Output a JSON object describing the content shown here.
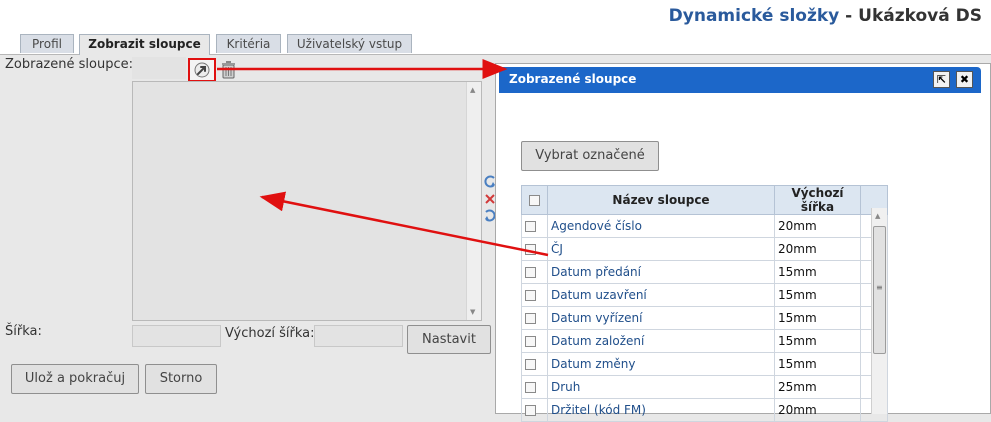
{
  "header": {
    "module": "Dynamické složky",
    "separator": " - ",
    "page": "Ukázková DS"
  },
  "tabs": [
    {
      "label": "Profil",
      "active": false
    },
    {
      "label": "Zobrazit sloupce",
      "active": true
    },
    {
      "label": "Kritéria",
      "active": false
    },
    {
      "label": "Uživatelský vstup",
      "active": false
    }
  ],
  "form": {
    "displayed_columns_label": "Zobrazené sloupce:",
    "width_label": "Šířka:",
    "default_width_label": "Výchozí šířka:",
    "set_button": "Nastavit",
    "save_continue_button": "Ulož a pokračuj",
    "cancel_button": "Storno"
  },
  "dialog": {
    "title": "Zobrazené sloupce",
    "select_marked_button": "Vybrat označené",
    "headers": {
      "name": "Název sloupce",
      "default_width": "Výchozí šířka"
    },
    "rows": [
      {
        "name": "Agendové číslo",
        "width": "20mm"
      },
      {
        "name": "ČJ",
        "width": "20mm"
      },
      {
        "name": "Datum předání",
        "width": "15mm"
      },
      {
        "name": "Datum uzavření",
        "width": "15mm"
      },
      {
        "name": "Datum vyřízení",
        "width": "15mm"
      },
      {
        "name": "Datum založení",
        "width": "15mm"
      },
      {
        "name": "Datum změny",
        "width": "15mm"
      },
      {
        "name": "Druh",
        "width": "25mm"
      },
      {
        "name": "Držitel (kód FM)",
        "width": "20mm"
      }
    ]
  },
  "colors": {
    "title_blue": "#2a5a9c",
    "dialog_header": "#1c67c9",
    "annotation_red": "#e01010",
    "link": "#1f4e8a"
  }
}
